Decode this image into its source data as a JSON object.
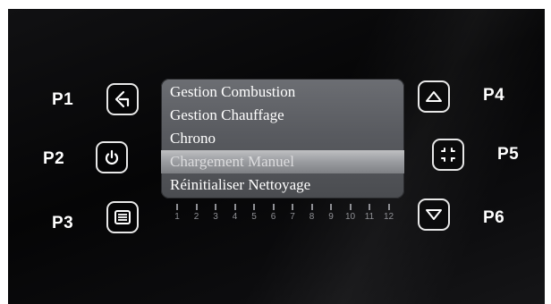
{
  "keys": [
    {
      "id": "P1",
      "label": "P1",
      "icon": "back-arrow-icon"
    },
    {
      "id": "P2",
      "label": "P2",
      "icon": "power-icon"
    },
    {
      "id": "P3",
      "label": "P3",
      "icon": "menu-list-icon"
    },
    {
      "id": "P4",
      "label": "P4",
      "icon": "up-arrow-icon"
    },
    {
      "id": "P5",
      "label": "P5",
      "icon": "select-focus-icon"
    },
    {
      "id": "P6",
      "label": "P6",
      "icon": "down-arrow-icon"
    }
  ],
  "menu": {
    "items": [
      {
        "label": "Gestion Combustion",
        "selected": false
      },
      {
        "label": "Gestion Chauffage",
        "selected": false
      },
      {
        "label": "Chrono",
        "selected": false
      },
      {
        "label": "Chargement Manuel",
        "selected": true
      },
      {
        "label": "Réinitialiser Nettoyage",
        "selected": false
      }
    ]
  },
  "scale": {
    "labels": [
      "1",
      "2",
      "3",
      "4",
      "5",
      "6",
      "7",
      "8",
      "9",
      "10",
      "11",
      "12"
    ]
  },
  "colors": {
    "panel_background": "#070708",
    "key_border": "#e8e8e8",
    "label_text": "#ffffff",
    "menu_background": "#5b5d62",
    "menu_selected": "#a3a5a9",
    "scale": "#8f9095"
  }
}
